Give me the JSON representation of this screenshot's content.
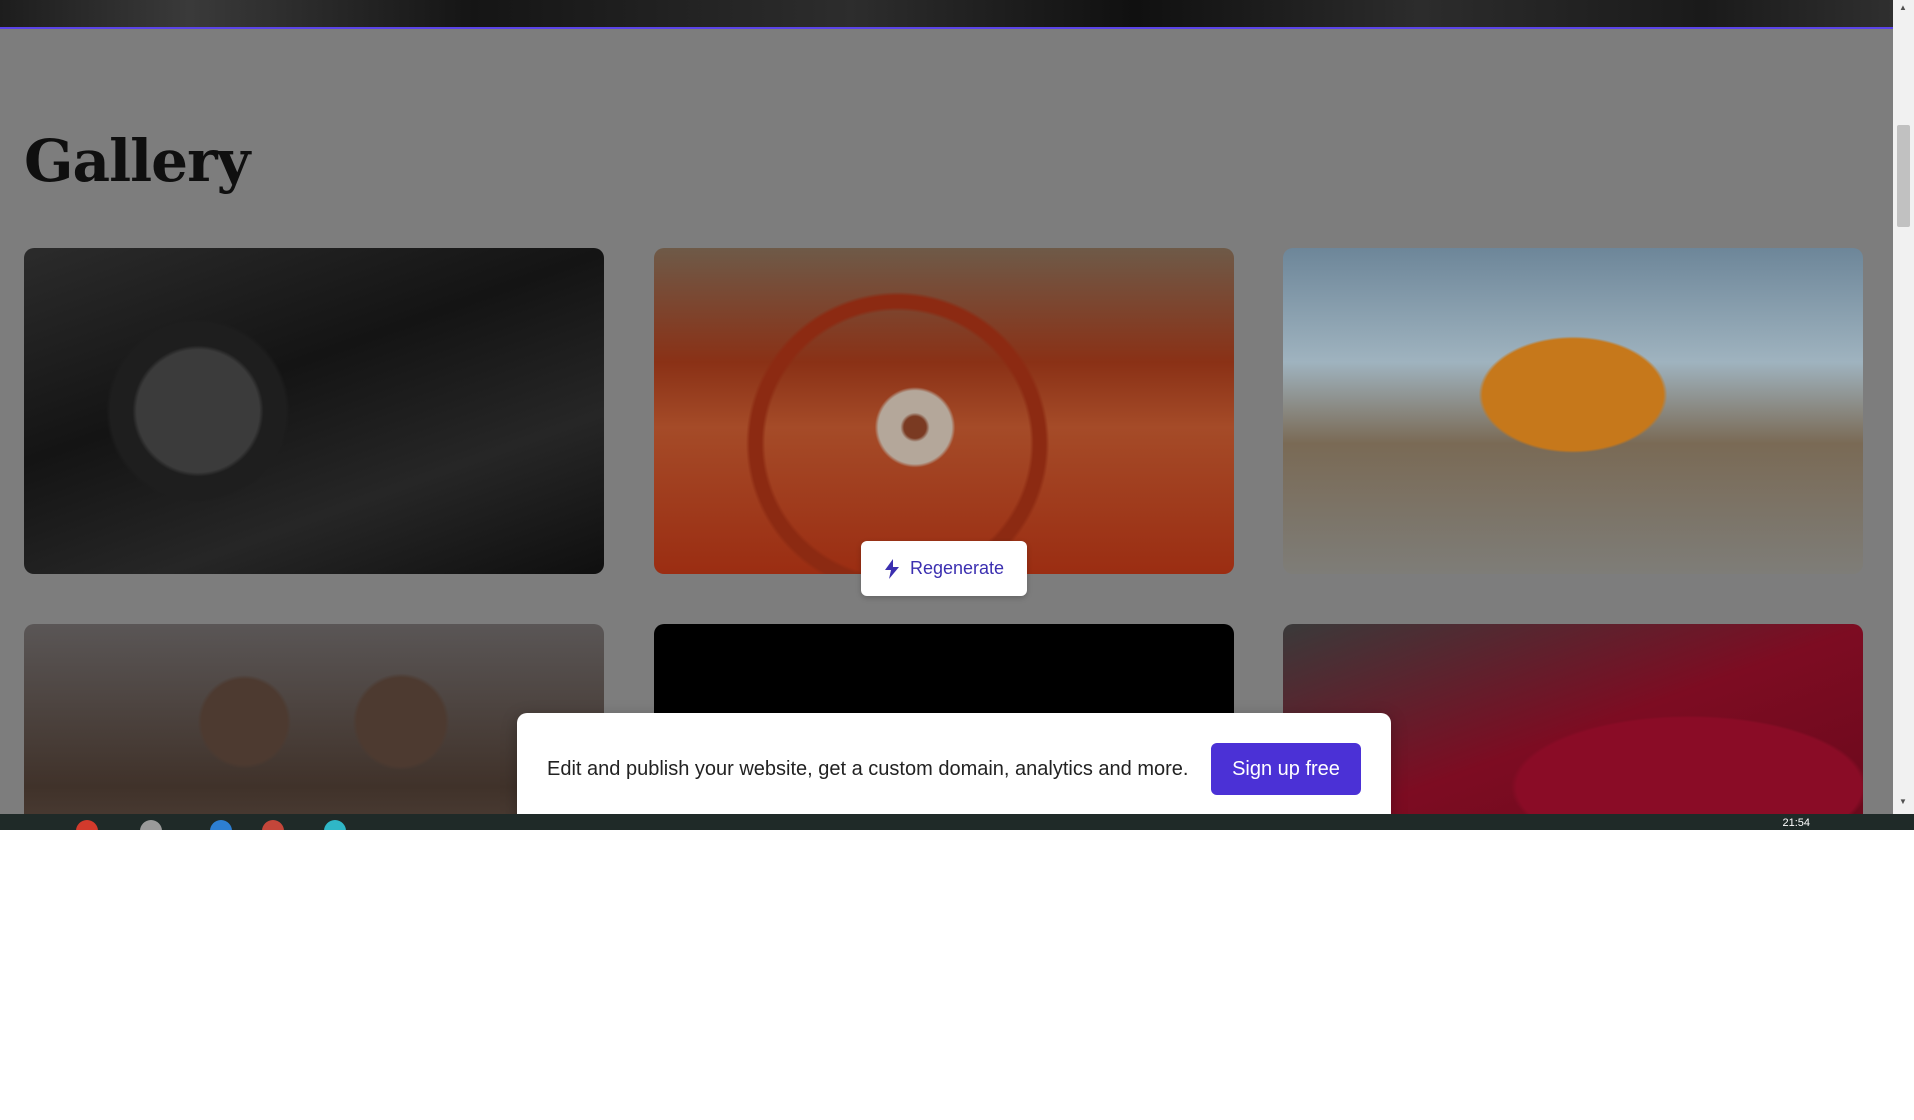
{
  "page": {
    "title": "Gallery"
  },
  "gallery": {
    "items": [
      {
        "name": "truck-interior-photo"
      },
      {
        "name": "classic-car-dashboard-photo"
      },
      {
        "name": "yellow-van-beach-photo"
      },
      {
        "name": "women-in-car-trunk-photo"
      },
      {
        "name": "dark-steering-wheel-photo"
      },
      {
        "name": "red-sports-car-photo"
      }
    ]
  },
  "regenerate": {
    "label": "Regenerate",
    "icon": "lightning-icon"
  },
  "banner": {
    "text": "Edit and publish your website, get a custom domain, analytics and more.",
    "button_label": "Sign up free"
  },
  "taskbar": {
    "clock": "21:54"
  },
  "colors": {
    "accent": "#4b31d6",
    "overlay": "#7d7d7d",
    "regenerate_text": "#3b2fb0"
  }
}
